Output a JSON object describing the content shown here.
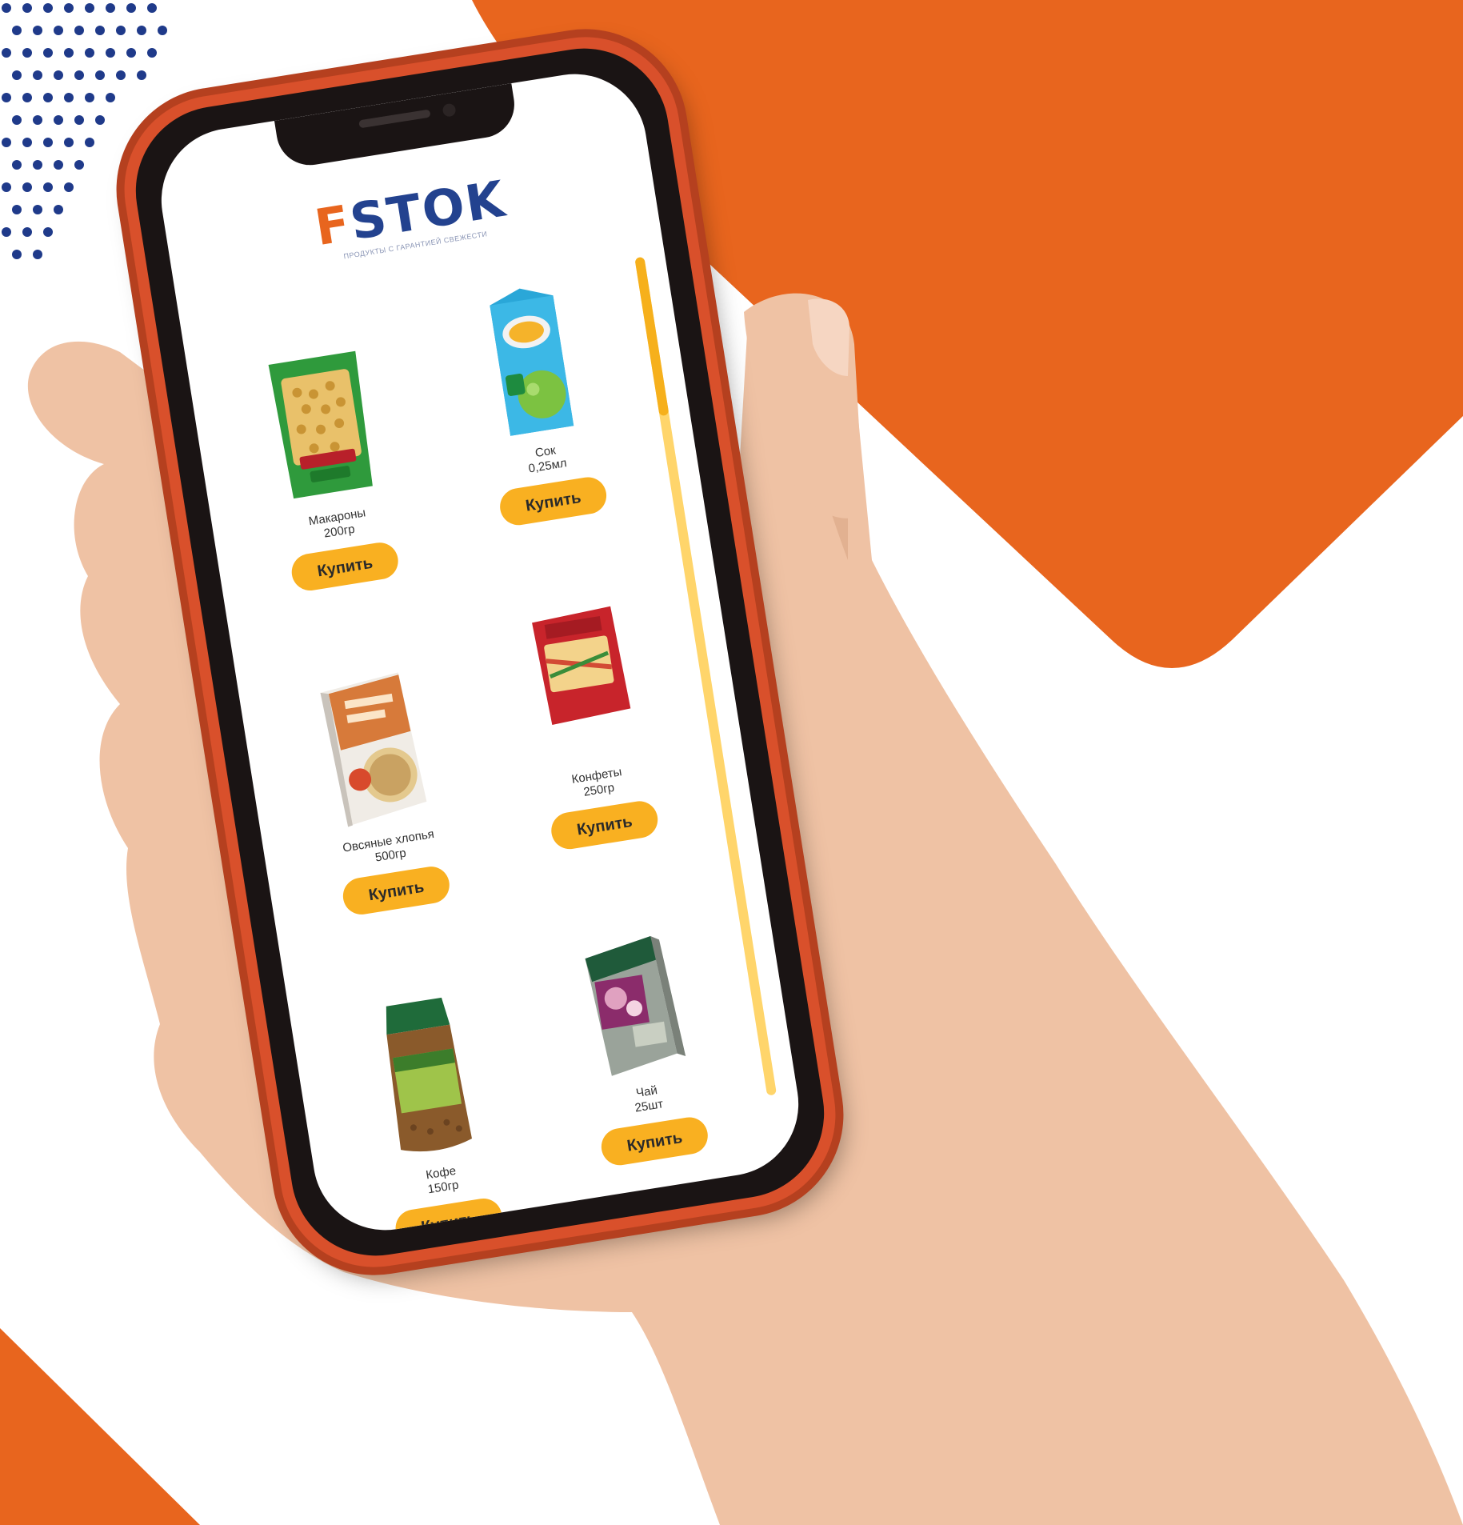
{
  "app": {
    "logo_text_main": "STOK",
    "logo_text_first": "F",
    "logo_tagline": "ПРОДУКТЫ С ГАРАНТИЕЙ СВЕЖЕСТИ"
  },
  "colors": {
    "accent_orange": "#e8651e",
    "brand_blue": "#23428f",
    "button_yellow": "#f9b021",
    "phone_frame": "#d9502b",
    "dots_navy": "#1f3a8a"
  },
  "scrollbar": {
    "position_fraction": 0.0
  },
  "products": [
    {
      "name": "Макароны",
      "qty": "200гр",
      "buy_label": "Купить",
      "icon": "pasta-package-icon"
    },
    {
      "name": "Сок",
      "qty": "0,25мл",
      "buy_label": "Купить",
      "icon": "juice-box-icon"
    },
    {
      "name": "Овсяные хлопья",
      "qty": "500гр",
      "buy_label": "Купить",
      "icon": "oat-flakes-box-icon"
    },
    {
      "name": "Конфеты",
      "qty": "250гр",
      "buy_label": "Купить",
      "icon": "candy-bag-icon"
    },
    {
      "name": "Кофе",
      "qty": "150гр",
      "buy_label": "Купить",
      "icon": "coffee-jar-icon"
    },
    {
      "name": "Чай",
      "qty": "25шт",
      "buy_label": "Купить",
      "icon": "tea-box-icon"
    }
  ]
}
